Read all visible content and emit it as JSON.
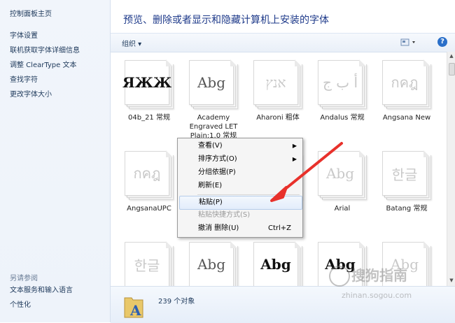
{
  "sidebar": {
    "home": "控制面板主页",
    "links": [
      "字体设置",
      "联机获取字体详细信息",
      "调整 ClearType 文本",
      "查找字符",
      "更改字体大小"
    ],
    "see_also_title": "另请参阅",
    "see_also": [
      "文本服务和输入语言",
      "个性化"
    ]
  },
  "header": {
    "title": "预览、删除或者显示和隐藏计算机上安装的字体"
  },
  "toolbar": {
    "organize": "组织 ▾",
    "help": "?"
  },
  "fonts": [
    {
      "name": "04b_21 常规",
      "sample": "ЯЖЖ",
      "style": "bold"
    },
    {
      "name": "Academy Engraved LET Plain:1.0 常规",
      "sample": "Abg",
      "style": "normal"
    },
    {
      "name": "Aharoni 粗体",
      "sample": "אנץ",
      "style": "faded"
    },
    {
      "name": "Andalus 常规",
      "sample": "أ ب ج",
      "style": "faded"
    },
    {
      "name": "Angsana New",
      "sample": "กคฎ",
      "style": "faded"
    },
    {
      "name": "AngsanaUPC",
      "sample": "กคฎ",
      "style": "faded"
    },
    {
      "name": "",
      "sample": "",
      "style": "faded"
    },
    {
      "name": "",
      "sample": "",
      "style": "faded"
    },
    {
      "name": "Arial",
      "sample": "Abg",
      "style": "faded"
    },
    {
      "name": "Batang 常规",
      "sample": "한글",
      "style": "faded"
    },
    {
      "name": "",
      "sample": "한글",
      "style": "faded"
    },
    {
      "name": "",
      "sample": "Abg",
      "style": "normal"
    },
    {
      "name": "",
      "sample": "Abg",
      "style": "bold"
    },
    {
      "name": "",
      "sample": "Abg",
      "style": "bold"
    },
    {
      "name": "",
      "sample": "Abg",
      "style": "faded"
    }
  ],
  "status": {
    "count": "239 个对象"
  },
  "context_menu": {
    "items": [
      {
        "label": "查看(V)",
        "submenu": true
      },
      {
        "label": "排序方式(O)",
        "submenu": true
      },
      {
        "label": "分组依据(P)",
        "submenu": true
      },
      {
        "label": "刷新(E)"
      },
      {
        "label": "粘贴(P)",
        "highlighted": true
      },
      {
        "label": "粘贴快捷方式(S)",
        "disabled": true
      },
      {
        "label": "撤消 删除(U)",
        "shortcut": "Ctrl+Z"
      }
    ]
  },
  "watermark": {
    "main": "搜狗指南",
    "sub": "zhinan.sogou.com"
  },
  "colors": {
    "accent": "#1e3a8a",
    "arrow": "#e8312b",
    "help": "#2a6fc9"
  }
}
